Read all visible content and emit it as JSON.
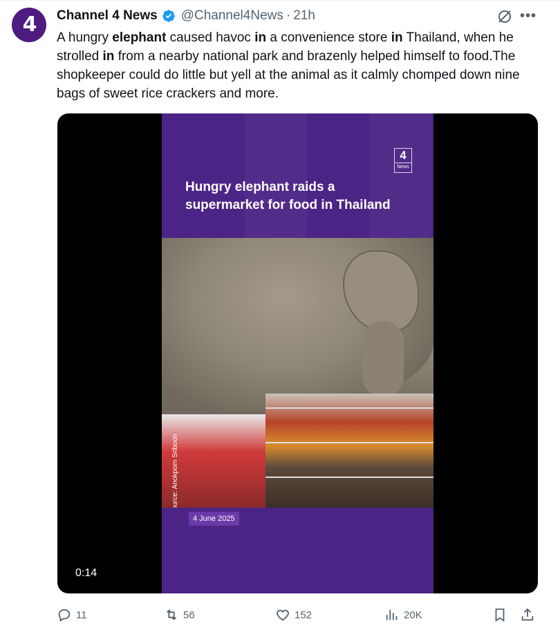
{
  "author": {
    "name": "Channel 4 News",
    "handle": "@Channel4News",
    "time": "21h",
    "avatar_logo": "4"
  },
  "tweet": {
    "segments": [
      {
        "text": "A hungry ",
        "bold": false
      },
      {
        "text": "elephant",
        "bold": true
      },
      {
        "text": " caused havoc ",
        "bold": false
      },
      {
        "text": "in",
        "bold": true
      },
      {
        "text": " a convenience store ",
        "bold": false
      },
      {
        "text": "in",
        "bold": true
      },
      {
        "text": " Thailand, when he strolled ",
        "bold": false
      },
      {
        "text": "in",
        "bold": true
      },
      {
        "text": " from a nearby national park and brazenly helped himself to food.The shopkeeper could do little but yell at the animal as it calmly chomped down nine bags of sweet rice crackers and more.",
        "bold": false
      }
    ]
  },
  "media": {
    "logo_number": "4",
    "logo_label": "News",
    "title": "Hungry elephant raids a supermarket for food in Thailand",
    "source": "Source: Anokporn Sriboon",
    "date": "4 June 2025",
    "duration": "0:14"
  },
  "actions": {
    "replies": "11",
    "reposts": "56",
    "likes": "152",
    "views": "20K"
  },
  "icons": {
    "verified": "verified-badge-icon",
    "grok": "grok-icon",
    "more": "more-icon",
    "reply": "reply-icon",
    "repost": "repost-icon",
    "like": "heart-icon",
    "views": "views-chart-icon",
    "bookmark": "bookmark-icon",
    "share": "share-icon"
  },
  "colors": {
    "brand_purple": "#4e1b80",
    "verified_blue": "#1d9bf0",
    "muted_text": "#536471"
  }
}
